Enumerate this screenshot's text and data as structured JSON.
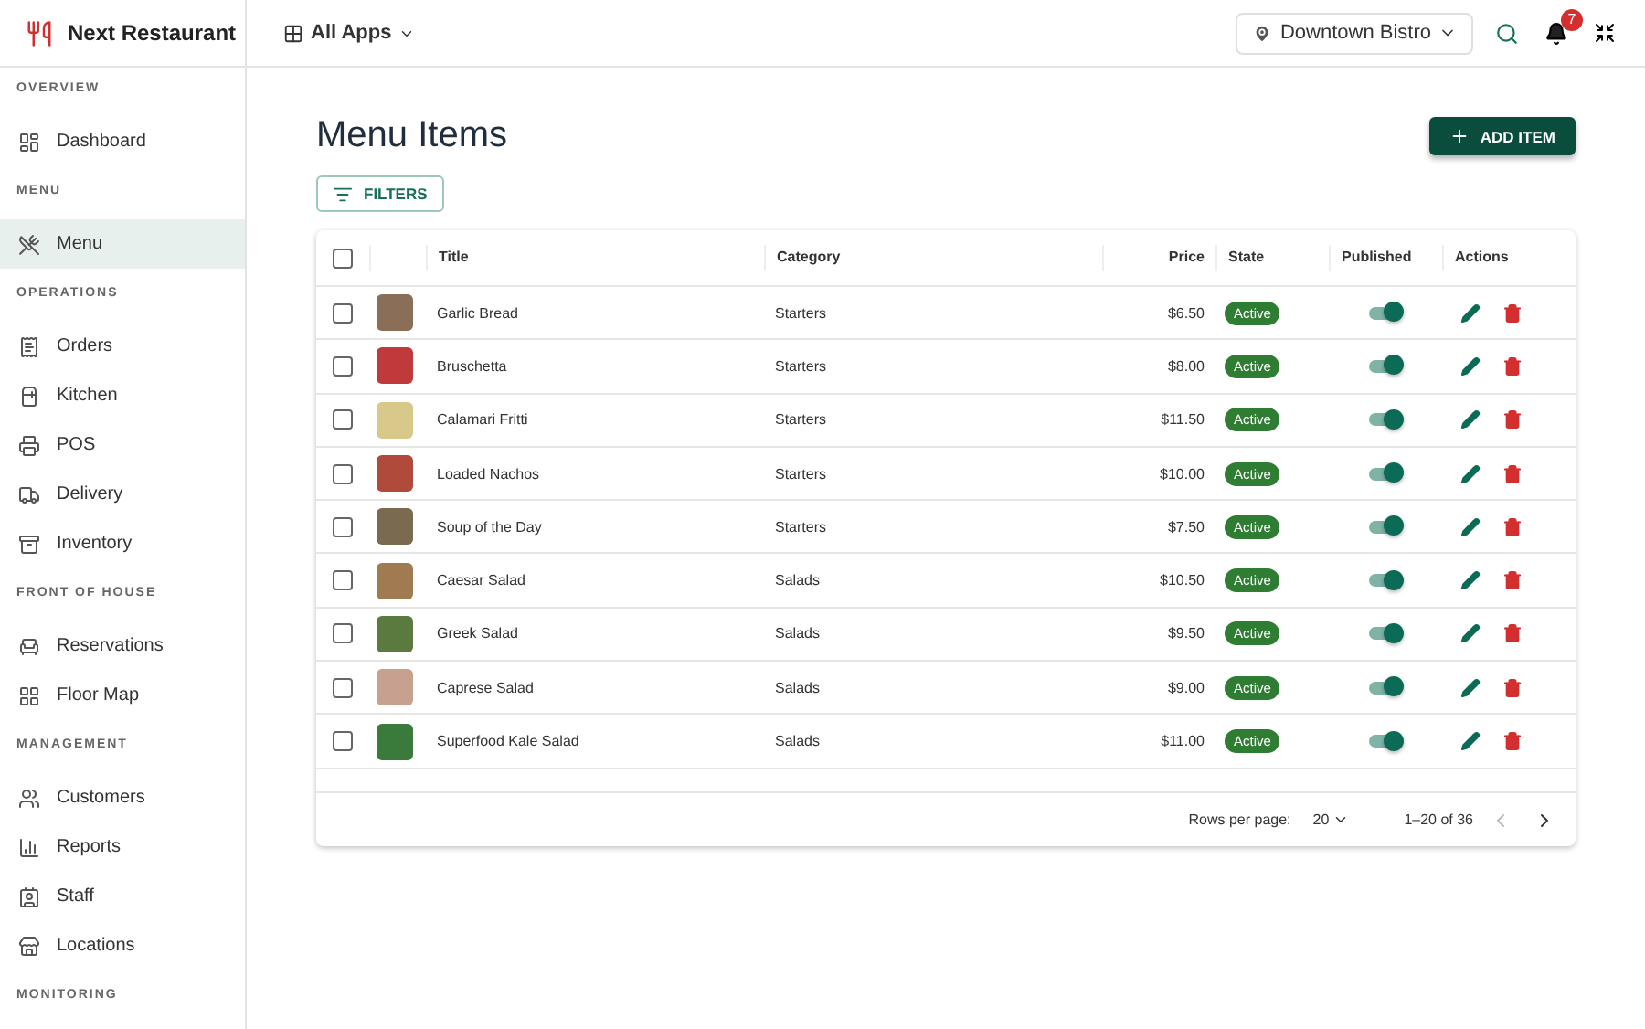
{
  "brand": {
    "name": "Next Restaurant"
  },
  "topbar": {
    "apps_label": "All Apps",
    "location": "Downtown Bistro",
    "notification_count": "7"
  },
  "sidebar": {
    "sections": [
      {
        "title": "OVERVIEW",
        "items": [
          {
            "label": "Dashboard",
            "selected": false
          }
        ]
      },
      {
        "title": "MENU",
        "items": [
          {
            "label": "Menu",
            "selected": true
          }
        ]
      },
      {
        "title": "OPERATIONS",
        "items": [
          {
            "label": "Orders",
            "selected": false
          },
          {
            "label": "Kitchen",
            "selected": false
          },
          {
            "label": "POS",
            "selected": false
          },
          {
            "label": "Delivery",
            "selected": false
          },
          {
            "label": "Inventory",
            "selected": false
          }
        ]
      },
      {
        "title": "FRONT OF HOUSE",
        "items": [
          {
            "label": "Reservations",
            "selected": false
          },
          {
            "label": "Floor Map",
            "selected": false
          }
        ]
      },
      {
        "title": "MANAGEMENT",
        "items": [
          {
            "label": "Customers",
            "selected": false
          },
          {
            "label": "Reports",
            "selected": false
          },
          {
            "label": "Staff",
            "selected": false
          },
          {
            "label": "Locations",
            "selected": false
          }
        ]
      },
      {
        "title": "MONITORING"
      }
    ]
  },
  "page": {
    "title": "Menu Items",
    "add_button": "ADD ITEM",
    "filters_button": "FILTERS"
  },
  "table": {
    "columns": [
      "Title",
      "Category",
      "Price",
      "State",
      "Published",
      "Actions"
    ],
    "all_checked": false,
    "rows": [
      {
        "title": "Garlic Bread",
        "category": "Starters",
        "price": "$6.50",
        "state": "Active",
        "published": true,
        "selected": false
      },
      {
        "title": "Bruschetta",
        "category": "Starters",
        "price": "$8.00",
        "state": "Active",
        "published": true,
        "selected": false
      },
      {
        "title": "Calamari Fritti",
        "category": "Starters",
        "price": "$11.50",
        "state": "Active",
        "published": true,
        "selected": false
      },
      {
        "title": "Loaded Nachos",
        "category": "Starters",
        "price": "$10.00",
        "state": "Active",
        "published": true,
        "selected": false
      },
      {
        "title": "Soup of the Day",
        "category": "Starters",
        "price": "$7.50",
        "state": "Active",
        "published": true,
        "selected": false
      },
      {
        "title": "Caesar Salad",
        "category": "Salads",
        "price": "$10.50",
        "state": "Active",
        "published": true,
        "selected": false
      },
      {
        "title": "Greek Salad",
        "category": "Salads",
        "price": "$9.50",
        "state": "Active",
        "published": true,
        "selected": false
      },
      {
        "title": "Caprese Salad",
        "category": "Salads",
        "price": "$9.00",
        "state": "Active",
        "published": true,
        "selected": false
      },
      {
        "title": "Superfood Kale Salad",
        "category": "Salads",
        "price": "$11.00",
        "state": "Active",
        "published": true,
        "selected": false
      }
    ],
    "pagination": {
      "rows_per_page_label": "Rows per page:",
      "rows_per_page": "20",
      "range": "1–20 of 36",
      "prev_disabled": true,
      "next_disabled": false
    }
  }
}
